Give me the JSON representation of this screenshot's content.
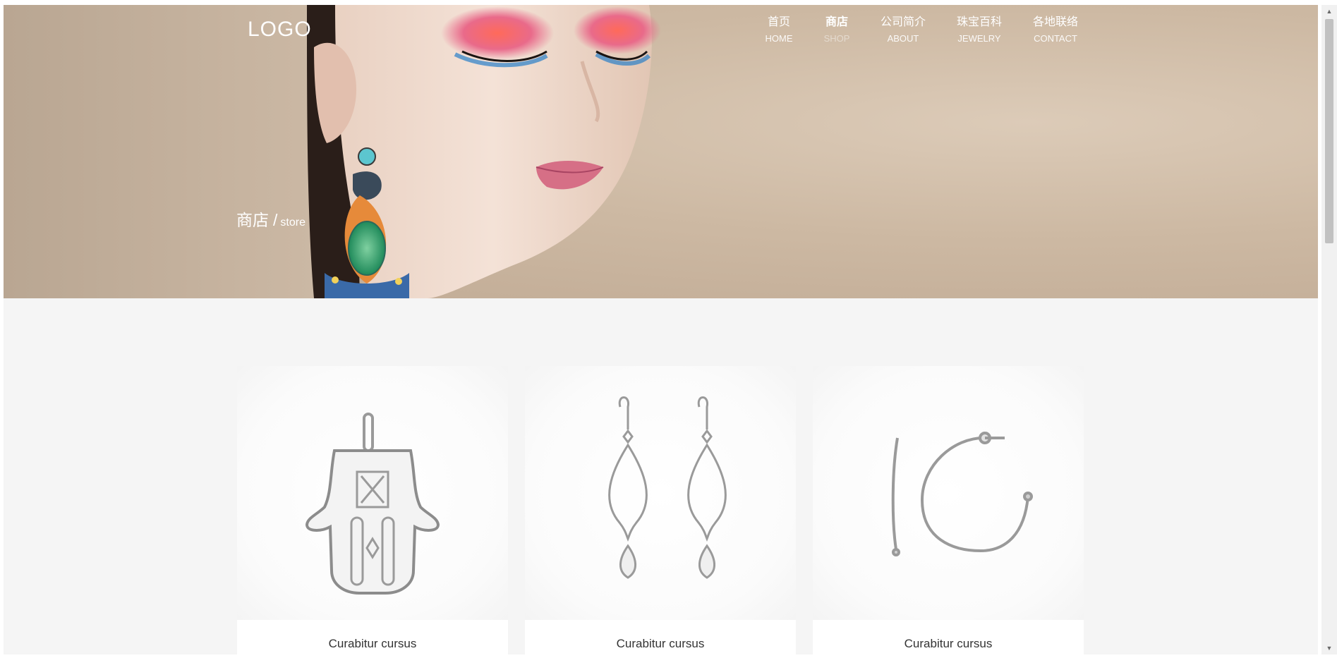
{
  "header": {
    "logo": "LOGO",
    "nav": [
      {
        "zh": "首页",
        "en": "HOME",
        "active": false
      },
      {
        "zh": "商店",
        "en": "SHOP",
        "active": true
      },
      {
        "zh": "公司简介",
        "en": "ABOUT",
        "active": false
      },
      {
        "zh": "珠宝百科",
        "en": "JEWELRY",
        "active": false
      },
      {
        "zh": "各地联络",
        "en": "CONTACT",
        "active": false
      }
    ]
  },
  "hero": {
    "breadcrumb_zh": "商店",
    "breadcrumb_sep": "/",
    "breadcrumb_en": "store"
  },
  "products": [
    {
      "title": "Curabitur cursus",
      "image": "hamsa-pendant"
    },
    {
      "title": "Curabitur cursus",
      "image": "drop-earrings"
    },
    {
      "title": "Curabitur cursus",
      "image": "hoop-earring"
    }
  ],
  "colors": {
    "hero_bg": "#cdb9a3",
    "page_bg": "#f5f5f5",
    "card_bg": "#ffffff",
    "text": "#333333"
  },
  "icons": {
    "scroll_up": "▲",
    "scroll_down": "▼"
  }
}
